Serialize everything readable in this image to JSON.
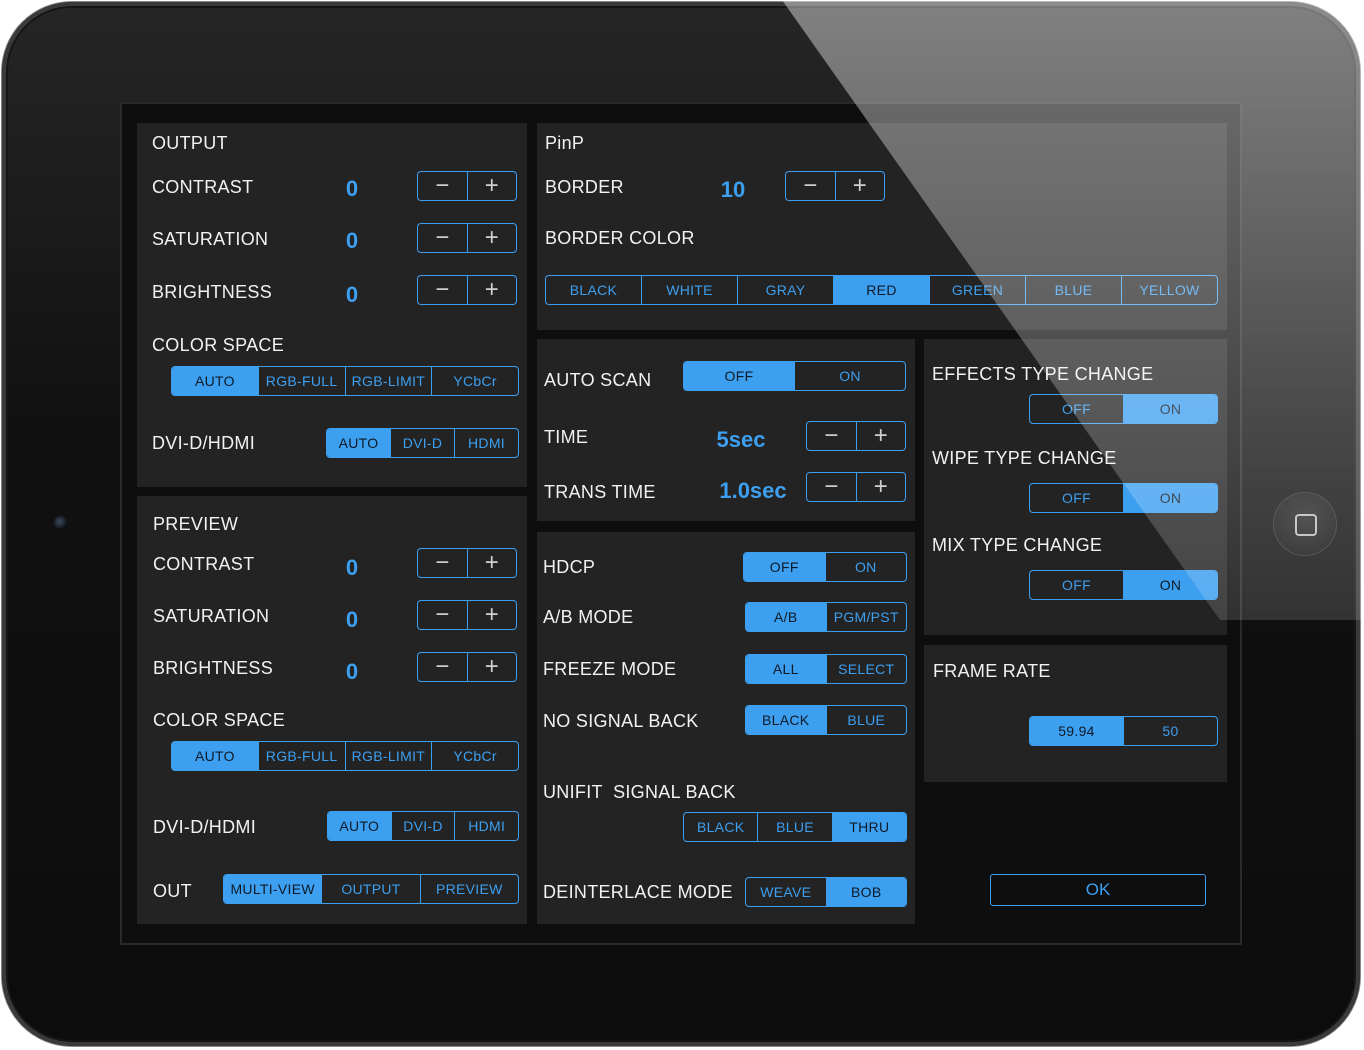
{
  "colors": {
    "accent": "#3d9ff0",
    "panel": "#232323",
    "screen": "#0e0e0e"
  },
  "icons": {
    "minus": "−",
    "plus": "+"
  },
  "output": {
    "title": "OUTPUT",
    "contrast": {
      "label": "CONTRAST",
      "value": "0"
    },
    "saturation": {
      "label": "SATURATION",
      "value": "0"
    },
    "brightness": {
      "label": "BRIGHTNESS",
      "value": "0"
    },
    "color_space": {
      "label": "COLOR SPACE",
      "options": [
        "AUTO",
        "RGB-FULL",
        "RGB-LIMIT",
        "YCbCr"
      ],
      "selected": "AUTO"
    },
    "dvi": {
      "label": "DVI-D/HDMI",
      "options": [
        "AUTO",
        "DVI-D",
        "HDMI"
      ],
      "selected": "AUTO"
    }
  },
  "preview": {
    "title": "PREVIEW",
    "contrast": {
      "label": "CONTRAST",
      "value": "0"
    },
    "saturation": {
      "label": "SATURATION",
      "value": "0"
    },
    "brightness": {
      "label": "BRIGHTNESS",
      "value": "0"
    },
    "color_space": {
      "label": "COLOR SPACE",
      "options": [
        "AUTO",
        "RGB-FULL",
        "RGB-LIMIT",
        "YCbCr"
      ],
      "selected": "AUTO"
    },
    "dvi": {
      "label": "DVI-D/HDMI",
      "options": [
        "AUTO",
        "DVI-D",
        "HDMI"
      ],
      "selected": "AUTO"
    },
    "out": {
      "label": "OUT",
      "options": [
        "MULTI-VIEW",
        "OUTPUT",
        "PREVIEW"
      ],
      "selected": "MULTI-VIEW"
    }
  },
  "pinp": {
    "title": "PinP",
    "border": {
      "label": "BORDER",
      "value": "10"
    },
    "border_color": {
      "label": "BORDER COLOR",
      "options": [
        "BLACK",
        "WHITE",
        "GRAY",
        "RED",
        "GREEN",
        "BLUE",
        "YELLOW"
      ],
      "selected": "RED"
    }
  },
  "scan": {
    "auto_scan": {
      "label": "AUTO SCAN",
      "options": [
        "OFF",
        "ON"
      ],
      "selected": "OFF"
    },
    "time": {
      "label": "TIME",
      "value": "5sec"
    },
    "trans_time": {
      "label": "TRANS TIME",
      "value": "1.0sec"
    }
  },
  "modes": {
    "hdcp": {
      "label": "HDCP",
      "options": [
        "OFF",
        "ON"
      ],
      "selected": "OFF"
    },
    "ab_mode": {
      "label": "A/B MODE",
      "options": [
        "A/B",
        "PGM/PST"
      ],
      "selected": "A/B"
    },
    "freeze_mode": {
      "label": "FREEZE MODE",
      "options": [
        "ALL",
        "SELECT"
      ],
      "selected": "ALL"
    },
    "no_signal_back": {
      "label": "NO SIGNAL BACK",
      "options": [
        "BLACK",
        "BLUE"
      ],
      "selected": "BLACK"
    },
    "unifit_signal_back": {
      "label": "UNIFIT  SIGNAL BACK",
      "options": [
        "BLACK",
        "BLUE",
        "THRU"
      ],
      "selected": "THRU"
    },
    "deinterlace_mode": {
      "label": "DEINTERLACE MODE",
      "options": [
        "WEAVE",
        "BOB"
      ],
      "selected": "BOB"
    }
  },
  "effects": {
    "effects_type_change": {
      "label": "EFFECTS TYPE CHANGE",
      "options": [
        "OFF",
        "ON"
      ],
      "selected": "ON"
    },
    "wipe_type_change": {
      "label": "WIPE TYPE CHANGE",
      "options": [
        "OFF",
        "ON"
      ],
      "selected": "ON"
    },
    "mix_type_change": {
      "label": "MIX TYPE CHANGE",
      "options": [
        "OFF",
        "ON"
      ],
      "selected": "ON"
    }
  },
  "frame_rate": {
    "label": "FRAME RATE",
    "options": [
      "59.94",
      "50"
    ],
    "selected": "59.94"
  },
  "ok_label": "OK"
}
